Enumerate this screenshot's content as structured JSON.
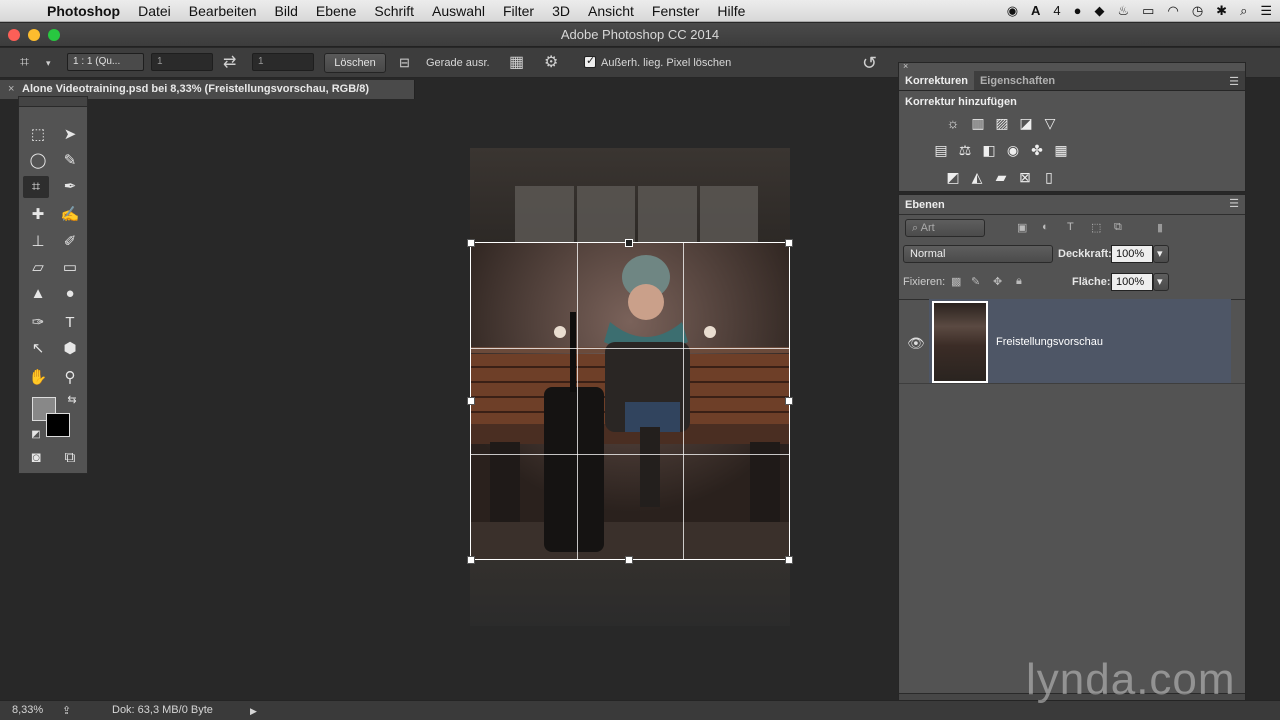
{
  "menubar": {
    "app": "Photoshop",
    "items": [
      "Datei",
      "Bearbeiten",
      "Bild",
      "Ebene",
      "Schrift",
      "Auswahl",
      "Filter",
      "3D",
      "Ansicht",
      "Fenster",
      "Hilfe"
    ],
    "status_badge": "4"
  },
  "window": {
    "title": "Adobe Photoshop CC 2014"
  },
  "options": {
    "ratio": "1 : 1 (Qu...",
    "width_value": "1",
    "height_value": "1",
    "clear_label": "Löschen",
    "straighten_label": "Gerade ausr.",
    "delete_pixels_label": "Außerh. lieg. Pixel löschen"
  },
  "document": {
    "tab_title": "Alone Videotraining.psd bei 8,33% (Freistellungsvorschau, RGB/8)"
  },
  "corrections": {
    "tab_active": "Korrekturen",
    "tab_other": "Eigenschaften",
    "add_label": "Korrektur hinzufügen"
  },
  "layers": {
    "tab": "Ebenen",
    "filter_placeholder": "Art",
    "blend_mode": "Normal",
    "opacity_label": "Deckkraft:",
    "opacity_value": "100%",
    "lock_label": "Fixieren:",
    "fill_label": "Fläche:",
    "fill_value": "100%",
    "layer_name": "Freistellungsvorschau"
  },
  "status": {
    "zoom": "8,33%",
    "doc_info": "Dok: 63,3 MB/0 Byte"
  },
  "watermark": "lynda.com",
  "colors": {
    "foreground": "#888888",
    "background": "#000000",
    "layer_selected": "#4e5666"
  }
}
